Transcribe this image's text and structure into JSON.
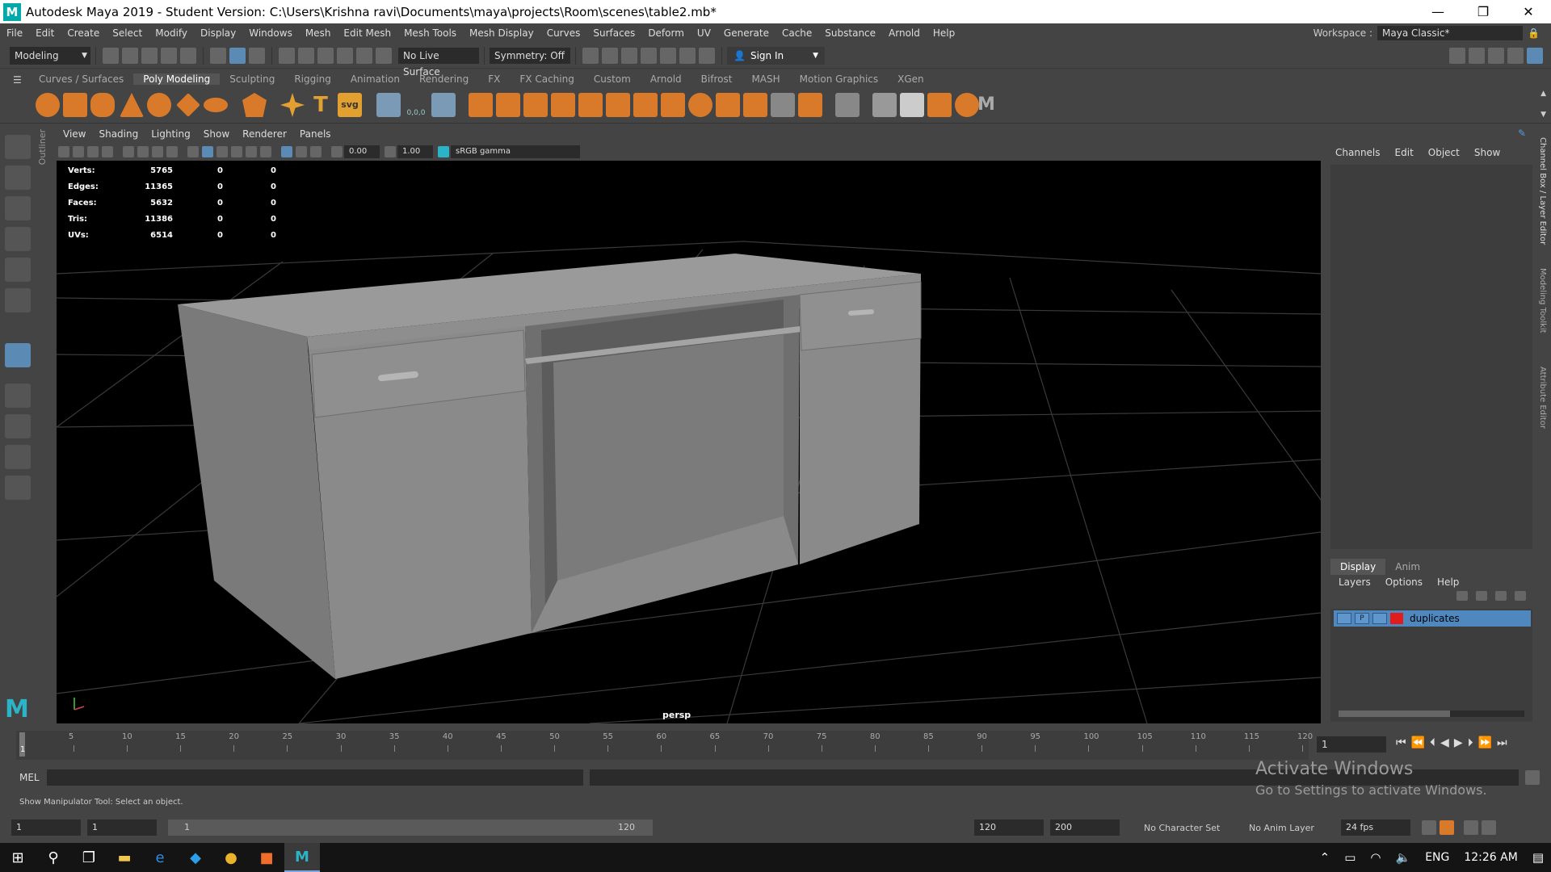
{
  "window": {
    "title": "Autodesk Maya 2019 - Student Version: C:\\Users\\Krishna ravi\\Documents\\maya\\projects\\Room\\scenes\\table2.mb*",
    "logo": "M",
    "minimize": "—",
    "restore": "❐",
    "close": "✕"
  },
  "menubar": {
    "items": [
      "File",
      "Edit",
      "Create",
      "Select",
      "Modify",
      "Display",
      "Windows",
      "Mesh",
      "Edit Mesh",
      "Mesh Tools",
      "Mesh Display",
      "Curves",
      "Surfaces",
      "Deform",
      "UV",
      "Generate",
      "Cache",
      "Substance",
      "Arnold",
      "Help"
    ],
    "workspace_label": "Workspace :",
    "workspace_value": "Maya Classic*"
  },
  "statusline": {
    "mode": "Modeling",
    "live_surface": "No Live Surface",
    "symmetry": "Symmetry: Off",
    "sign_in": "Sign In"
  },
  "shelf": {
    "tabs": [
      "Curves / Surfaces",
      "Poly Modeling",
      "Sculpting",
      "Rigging",
      "Animation",
      "Rendering",
      "FX",
      "FX Caching",
      "Custom",
      "Arnold",
      "Bifrost",
      "MASH",
      "Motion Graphics",
      "XGen"
    ],
    "active_tab": "Poly Modeling",
    "text_icon": "T",
    "svg_icon": "svg",
    "coord_icon": "0,0,0",
    "logo_icon": "M"
  },
  "outliner_label": "Outliner",
  "viewport": {
    "menu": [
      "View",
      "Shading",
      "Lighting",
      "Show",
      "Renderer",
      "Panels"
    ],
    "exposure": "0.00",
    "gamma": "1.00",
    "colorspace": "sRGB gamma",
    "camera": "persp",
    "hud": [
      {
        "label": "Verts:",
        "v1": "5765",
        "v2": "0",
        "v3": "0"
      },
      {
        "label": "Edges:",
        "v1": "11365",
        "v2": "0",
        "v3": "0"
      },
      {
        "label": "Faces:",
        "v1": "5632",
        "v2": "0",
        "v3": "0"
      },
      {
        "label": "Tris:",
        "v1": "11386",
        "v2": "0",
        "v3": "0"
      },
      {
        "label": "UVs:",
        "v1": "6514",
        "v2": "0",
        "v3": "0"
      }
    ]
  },
  "channelbox": {
    "menu": [
      "Channels",
      "Edit",
      "Object",
      "Show"
    ],
    "side_tabs": [
      "Channel Box / Layer Editor",
      "Modeling Toolkit",
      "Attribute Editor"
    ]
  },
  "layers": {
    "tabs": [
      "Display",
      "Anim"
    ],
    "active_tab": "Display",
    "menu": [
      "Layers",
      "Options",
      "Help"
    ],
    "rows": [
      {
        "v": "",
        "p": "P",
        "r": "",
        "name": "duplicates",
        "color": "#e21b1b"
      }
    ]
  },
  "timeline": {
    "ticks": [
      "5",
      "10",
      "15",
      "20",
      "25",
      "30",
      "35",
      "40",
      "45",
      "50",
      "55",
      "60",
      "65",
      "70",
      "75",
      "80",
      "85",
      "90",
      "95",
      "100",
      "105",
      "110",
      "115",
      "120"
    ],
    "current_frame": "1",
    "current_frame_field": "1"
  },
  "command": {
    "language": "MEL",
    "help_text": "Show Manipulator Tool: Select an object."
  },
  "range": {
    "start": "1",
    "playback_start": "1",
    "slider_start": "1",
    "slider_end": "120",
    "playback_end": "120",
    "end": "200",
    "character_set": "No Character Set",
    "anim_layer": "No Anim Layer",
    "fps": "24 fps"
  },
  "watermark": {
    "line1": "Activate Windows",
    "line2": "Go to Settings to activate Windows."
  },
  "taskbar": {
    "language": "ENG",
    "time": "12:26 AM"
  }
}
